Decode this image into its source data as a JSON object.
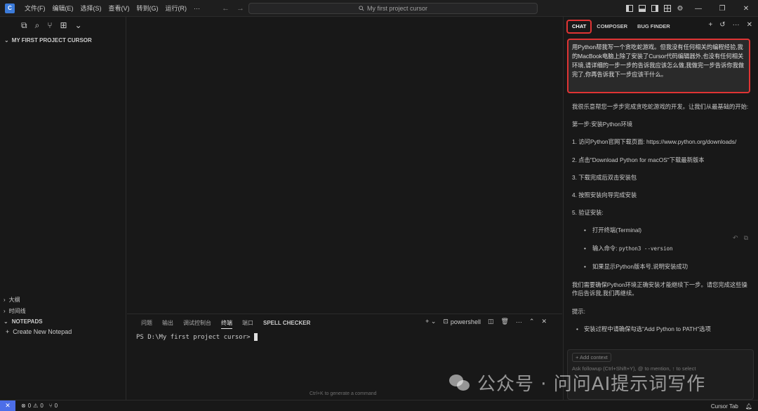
{
  "titlebar": {
    "logo": "C",
    "menus": [
      "文件(F)",
      "编辑(E)",
      "选择(S)",
      "查看(V)",
      "转到(G)",
      "运行(R)",
      "···"
    ],
    "search_text": "My first project cursor",
    "icons": [
      "layout-sidebar-left-icon",
      "layout-panel-icon",
      "layout-sidebar-right-icon",
      "layout-grid-icon",
      "gear-icon"
    ]
  },
  "explorer": {
    "project_title": "MY FIRST PROJECT CURSOR",
    "sections": [
      {
        "label": "大纲"
      },
      {
        "label": "时间线"
      },
      {
        "label": "NOTEPADS"
      }
    ],
    "create_notepad": "Create New Notepad"
  },
  "panel": {
    "tabs": [
      "问题",
      "输出",
      "调试控制台",
      "终端",
      "端口",
      "SPELL CHECKER"
    ],
    "active_tab": "终端",
    "shell": "powershell",
    "terminal_prompt": "PS D:\\My first project cursor>",
    "hint": "Ctrl+K to generate a command"
  },
  "chat": {
    "tabs": [
      "CHAT",
      "COMPOSER",
      "BUG FINDER"
    ],
    "active_tab": "CHAT",
    "prompt": "用Python帮我写一个贪吃蛇游戏。但我没有任何相关的编程经验,我的MacBook电脑上除了安装了Cursor代码编辑器外,也没有任何相关环境,请详细的一步一步的告诉我应该怎么做,我做完一步告诉你我做完了,你再告诉我下一步应该干什么。",
    "response": {
      "intro": "我很乐意帮您一步步完成贪吃蛇游戏的开发。让我们从最基础的开始:",
      "step_title": "第一步:安装Python环境",
      "steps": [
        "1. 访问Python官网下载页面: https://www.python.org/downloads/",
        "2. 点击\"Download Python for macOS\"下载最新版本",
        "3. 下载完成后双击安装包",
        "4. 按照安装向导完成安装",
        "5. 验证安装:"
      ],
      "verify": {
        "open_terminal": "打开终端(Terminal)",
        "input_prefix": "输入命令: ",
        "command": "python3 --version",
        "success": "如果显示Python版本号,说明安装成功"
      },
      "followup_note": "我们需要确保Python环境正确安装才能继续下一步。请您完成这些操作后告诉我,我们再继续。",
      "tips_title": "提示:",
      "tip": "安装过程中请确保勾选\"Add Python to PATH\"选项"
    },
    "add_context": "+ Add context",
    "followup_placeholder": "Ask followup (Ctrl+Shift+Y), @ to mention, ↑ to select"
  },
  "watermark": {
    "text": "公众号 · 问问AI提示词写作"
  },
  "statusbar": {
    "remote": "✕",
    "errors": "0",
    "warnings": "0",
    "ports": "0",
    "cursor_tab": "Cursor Tab"
  }
}
